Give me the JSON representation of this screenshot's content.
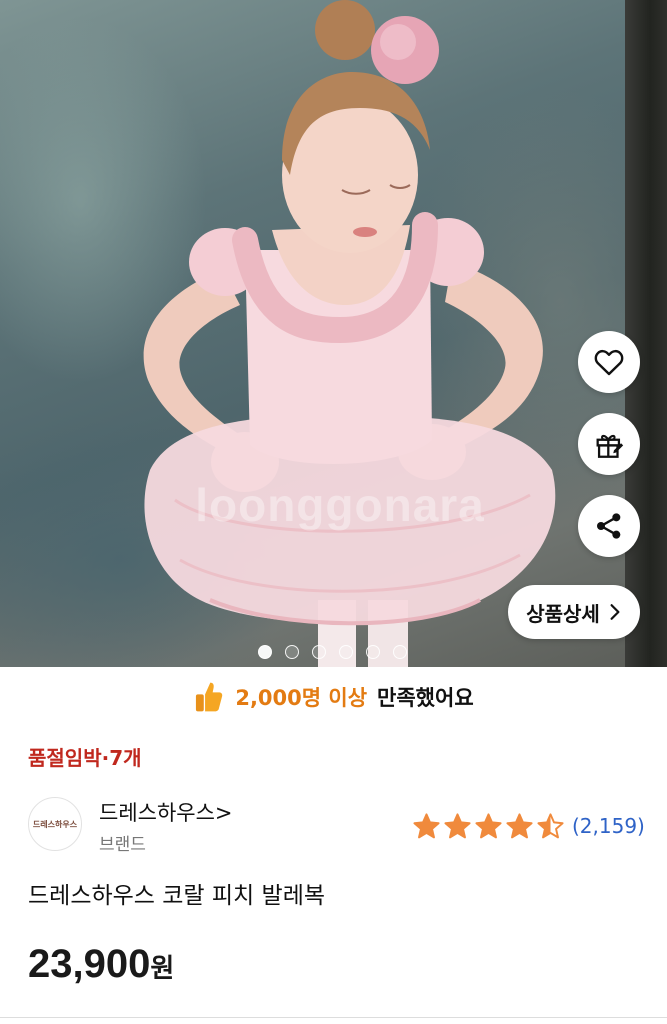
{
  "hero": {
    "watermark": "loonggonara",
    "detail_button_label": "상품상세",
    "page_count": 6,
    "active_page": 1
  },
  "banner": {
    "highlight": "2,000명 이상",
    "rest": "만족했어요"
  },
  "stock_notice": "품절임박·7개",
  "brand": {
    "name": "드레스하우스>",
    "sub_label": "브랜드",
    "logo_text": "드레스하우스"
  },
  "rating": {
    "stars": 4.5,
    "review_count": "(2,159)"
  },
  "product": {
    "name": "드레스하우스 코랄 피치 발레복",
    "price_number": "23,900",
    "price_unit": "원"
  },
  "colors": {
    "accent_orange": "#e37b12",
    "soldout_red": "#c0281e",
    "review_blue": "#2f63c7",
    "star": "#f08a3c"
  },
  "icons": {
    "wishlist": "heart-icon",
    "gift": "gift-icon",
    "share": "share-icon",
    "thumb": "thumbs-up-icon",
    "chevron": "chevron-right-icon"
  }
}
